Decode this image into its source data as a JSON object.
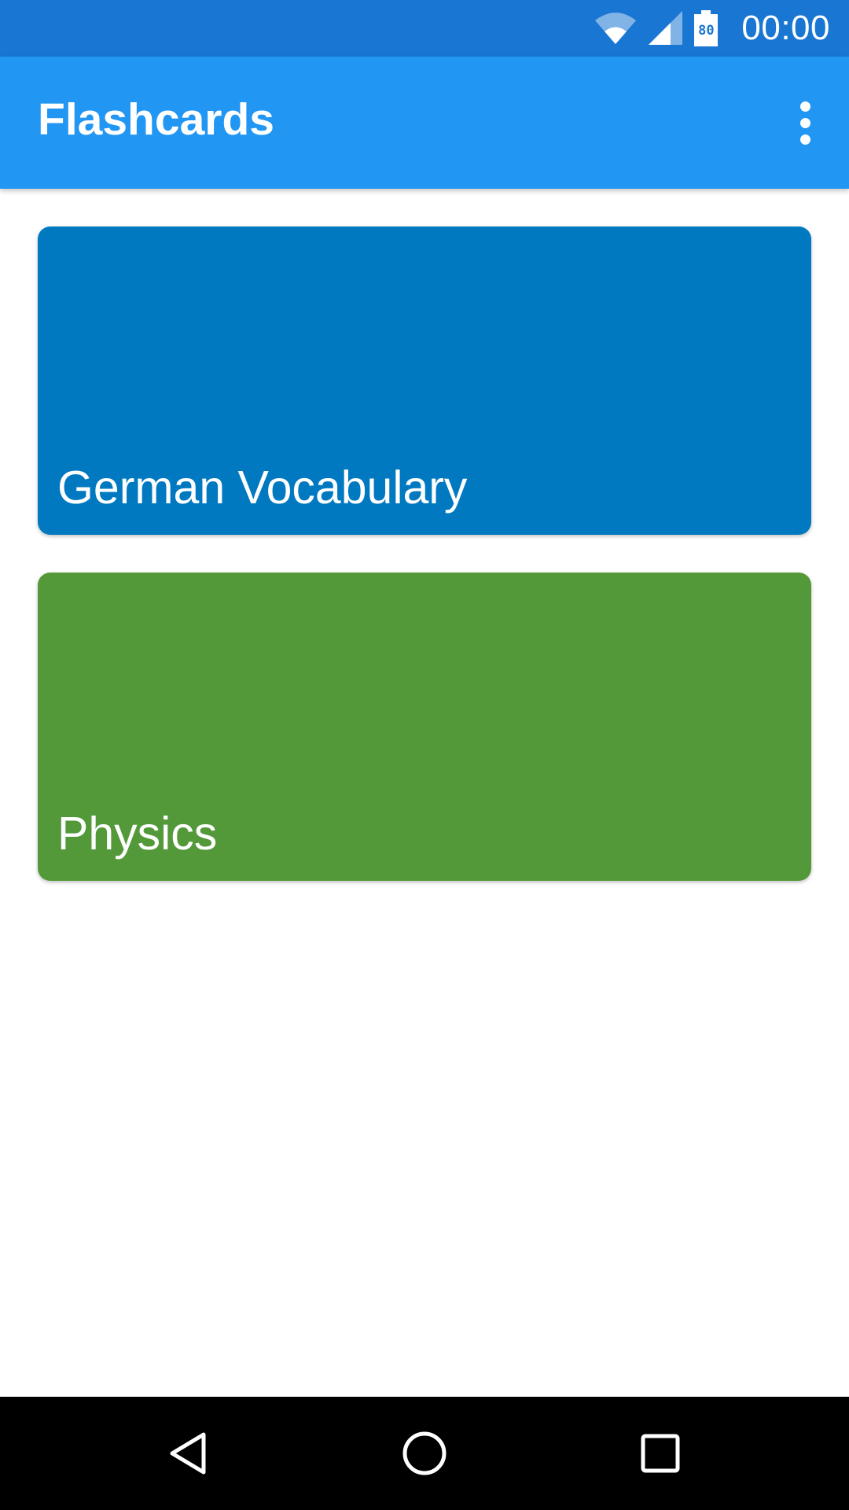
{
  "status_bar": {
    "time": "00:00",
    "battery_level": "80",
    "background": "#1976d2",
    "icons": [
      "wifi-icon",
      "cellular-signal-icon",
      "battery-icon"
    ]
  },
  "app_bar": {
    "title": "Flashcards",
    "background": "#2196f3",
    "menu_icon": "more-vert-icon"
  },
  "decks": [
    {
      "title": "German Vocabulary",
      "color": "#0079c0"
    },
    {
      "title": "Physics",
      "color": "#539939"
    }
  ],
  "nav_bar": {
    "background": "#000000",
    "buttons": [
      "back-icon",
      "home-icon",
      "recents-icon"
    ]
  }
}
